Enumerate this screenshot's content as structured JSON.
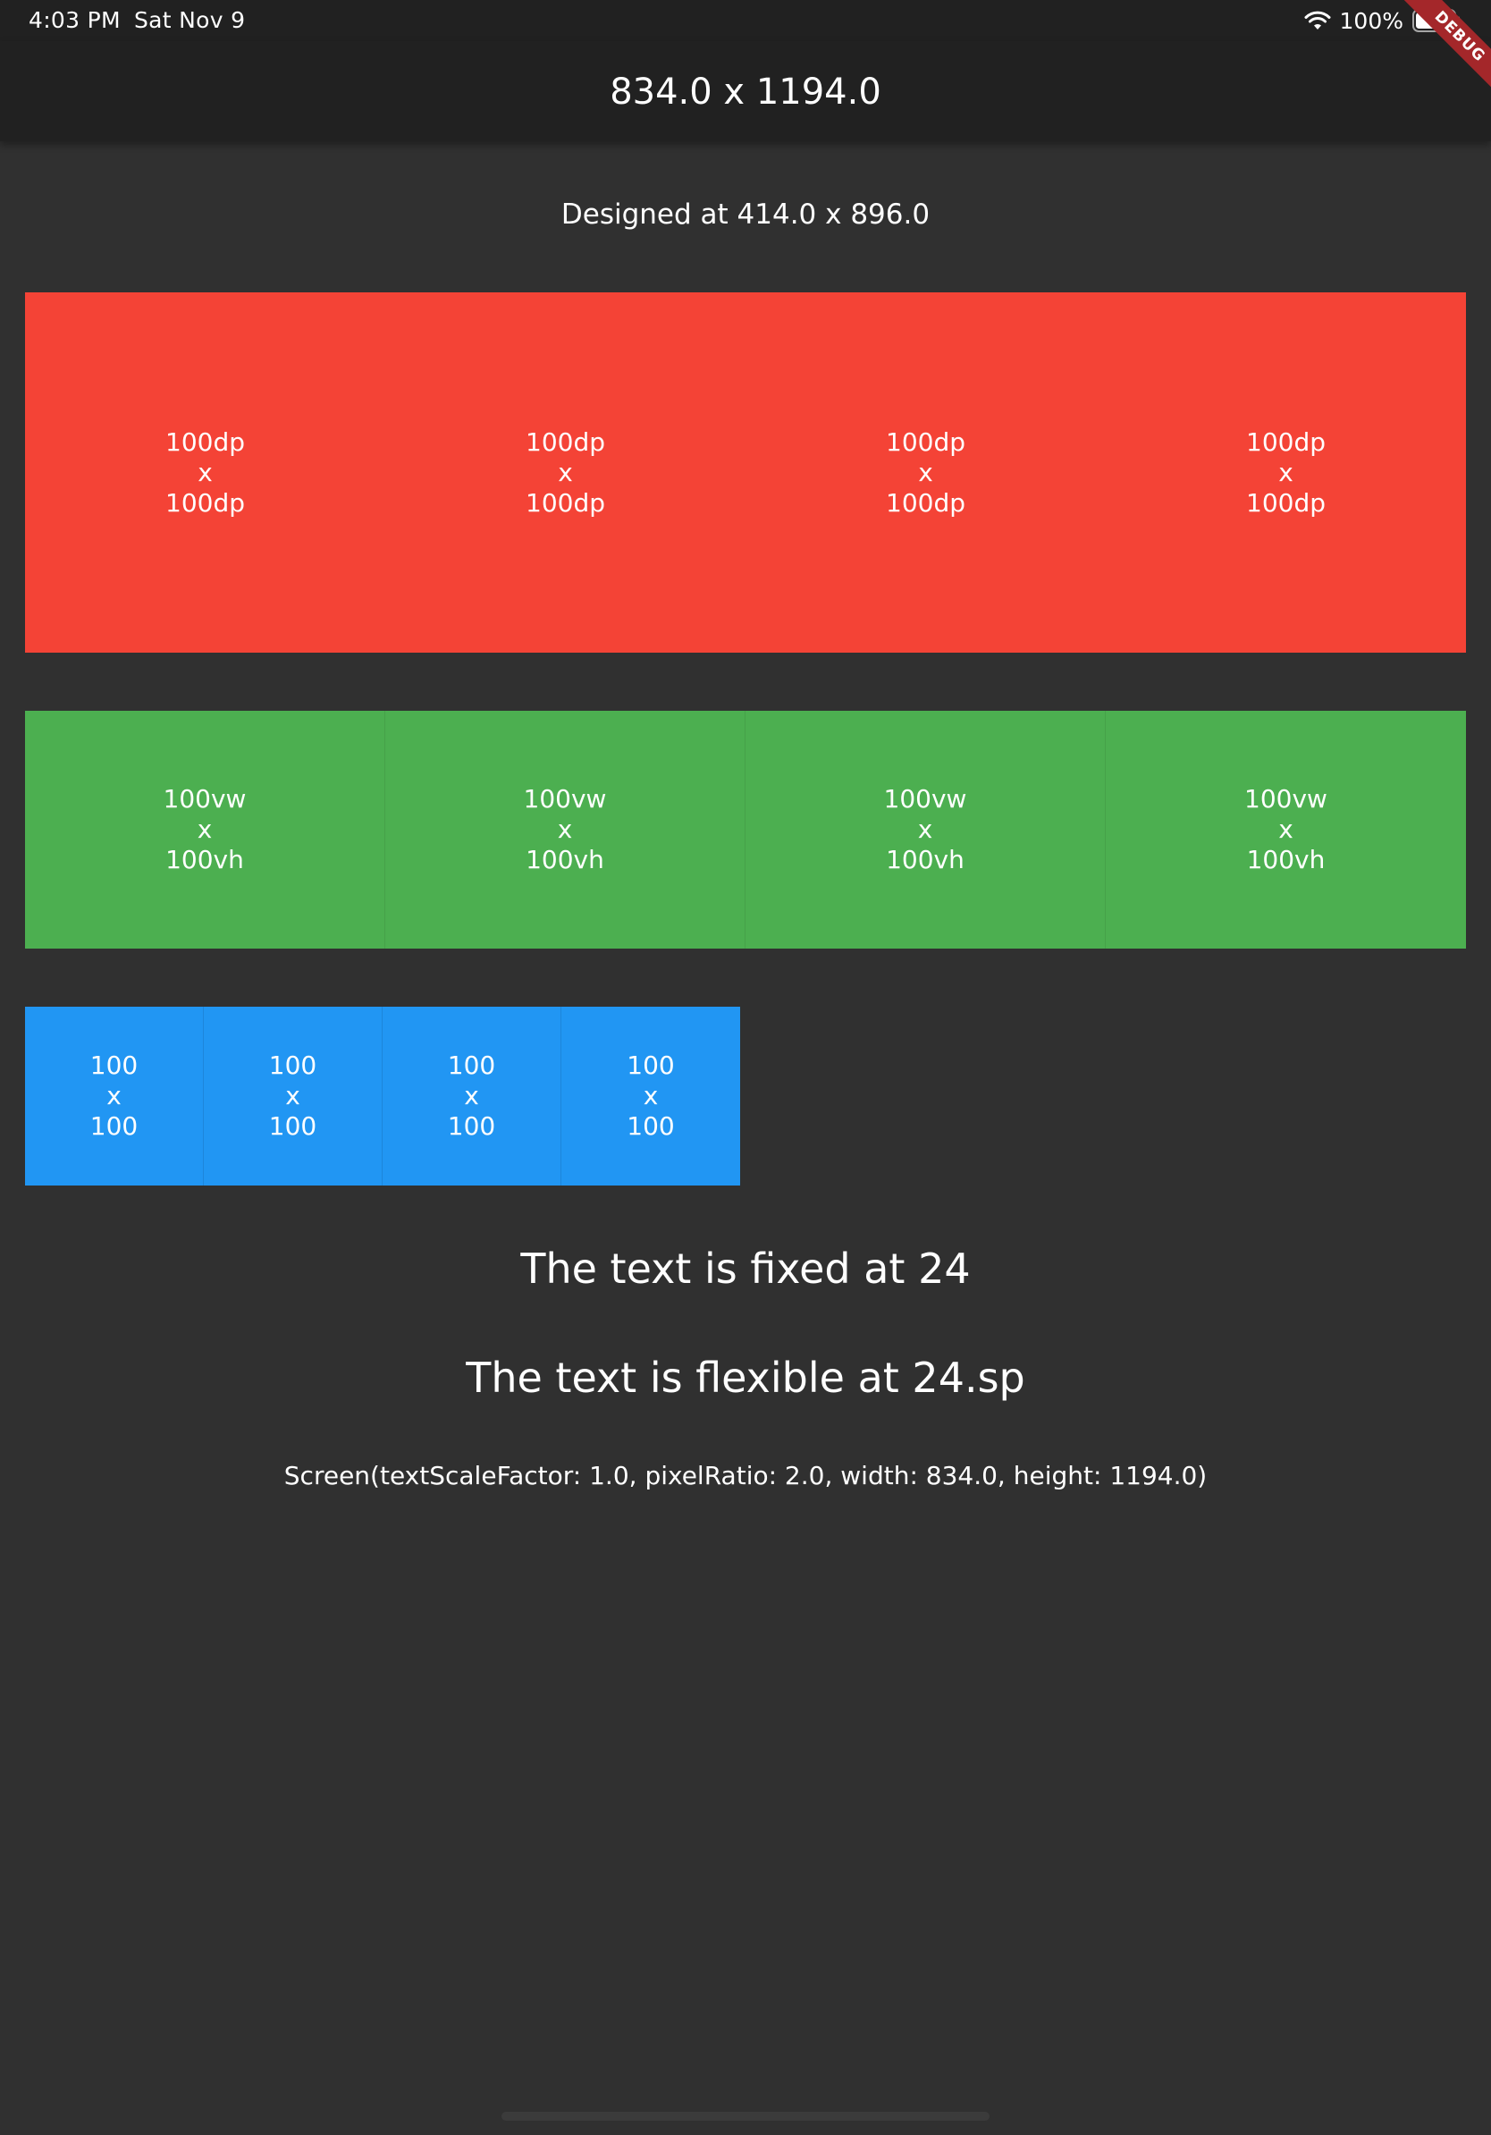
{
  "status_bar": {
    "time": "4:03 PM",
    "date": "Sat Nov 9",
    "battery_percent": "100%",
    "wifi_icon": "wifi-icon",
    "battery_icon": "battery-full-icon"
  },
  "app_bar": {
    "title": "834.0 x 1194.0"
  },
  "debug_banner": {
    "label": "DEBUG",
    "color": "#a4272a"
  },
  "designed_text": "Designed at 414.0 x 896.0",
  "red_row": {
    "color": "#f44336",
    "cells": [
      {
        "top": "100dp",
        "mid": "x",
        "bottom": "100dp"
      },
      {
        "top": "100dp",
        "mid": "x",
        "bottom": "100dp"
      },
      {
        "top": "100dp",
        "mid": "x",
        "bottom": "100dp"
      },
      {
        "top": "100dp",
        "mid": "x",
        "bottom": "100dp"
      }
    ]
  },
  "green_row": {
    "color": "#4caf50",
    "cells": [
      {
        "top": "100vw",
        "mid": "x",
        "bottom": "100vh"
      },
      {
        "top": "100vw",
        "mid": "x",
        "bottom": "100vh"
      },
      {
        "top": "100vw",
        "mid": "x",
        "bottom": "100vh"
      },
      {
        "top": "100vw",
        "mid": "x",
        "bottom": "100vh"
      }
    ]
  },
  "blue_row": {
    "color": "#2196f3",
    "cells": [
      {
        "top": "100",
        "mid": "x",
        "bottom": "100"
      },
      {
        "top": "100",
        "mid": "x",
        "bottom": "100"
      },
      {
        "top": "100",
        "mid": "x",
        "bottom": "100"
      },
      {
        "top": "100",
        "mid": "x",
        "bottom": "100"
      }
    ]
  },
  "fixed_text": "The text is fixed at 24",
  "flexible_text": "The text is flexible at 24.sp",
  "screen_info": "Screen(textScaleFactor: 1.0, pixelRatio: 2.0, width: 834.0, height: 1194.0)",
  "colors": {
    "background": "#303030",
    "app_bar": "#212121"
  }
}
